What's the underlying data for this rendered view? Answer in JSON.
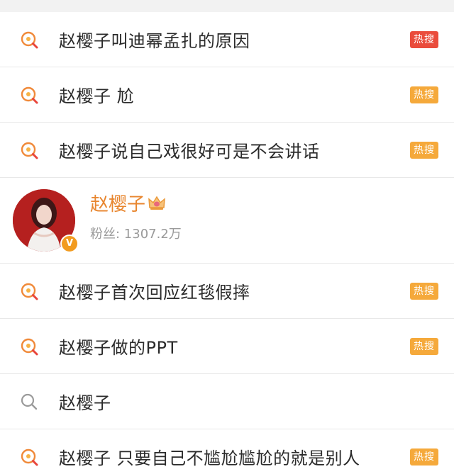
{
  "results": [
    {
      "text": "赵樱子叫迪幂孟扎的原因",
      "badge": "热搜",
      "badge_color": "#ea4c3c",
      "icon": "hot-search-icon"
    },
    {
      "text": "赵樱子 尬",
      "badge": "热搜",
      "badge_color": "#f5a93b",
      "icon": "hot-search-icon"
    },
    {
      "text": "赵樱子说自己戏很好可是不会讲话",
      "badge": "热搜",
      "badge_color": "#f5a93b",
      "icon": "hot-search-icon"
    }
  ],
  "user": {
    "name": "赵樱子",
    "fans_label": "粉丝: 1307.2万",
    "verified_mark": "V",
    "crown_icon": "crown-icon"
  },
  "results_after": [
    {
      "text": "赵樱子首次回应红毯假摔",
      "badge": "热搜",
      "badge_color": "#f5a93b",
      "icon": "hot-search-icon"
    },
    {
      "text": "赵樱子做的PPT",
      "badge": "热搜",
      "badge_color": "#f5a93b",
      "icon": "hot-search-icon"
    },
    {
      "text": "赵樱子",
      "badge": "",
      "icon": "search-icon"
    },
    {
      "text": "赵樱子 只要自己不尴尬尴尬的就是别人",
      "badge": "热搜",
      "badge_color": "#f5a93b",
      "icon": "hot-search-icon"
    }
  ]
}
